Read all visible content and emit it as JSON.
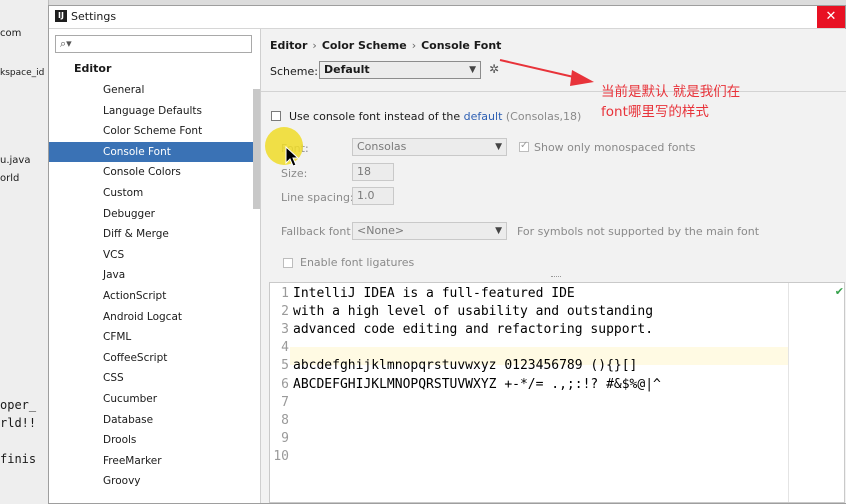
{
  "background_ide": {
    "lines": [
      "com",
      "kspace_id",
      "u.java",
      "orld",
      "oper_",
      "rld!!",
      "finis"
    ]
  },
  "window": {
    "title": "Settings",
    "icon_text": "IJ",
    "close_label": "✕"
  },
  "left_panel": {
    "search_icon": "search-icon",
    "root": "Editor",
    "items": [
      "General",
      "Language Defaults",
      "Color Scheme Font",
      "Console Font",
      "Console Colors",
      "Custom",
      "Debugger",
      "Diff & Merge",
      "VCS",
      "Java",
      "ActionScript",
      "Android Logcat",
      "CFML",
      "CoffeeScript",
      "CSS",
      "Cucumber",
      "Database",
      "Drools",
      "FreeMarker",
      "Groovy"
    ],
    "selected_index": 3
  },
  "breadcrumb": [
    "Editor",
    "Color Scheme",
    "Console Font"
  ],
  "scheme": {
    "label": "Scheme:",
    "value": "Default"
  },
  "use_console_font": {
    "label_prefix": "Use console font instead of the",
    "link": "default",
    "suffix": "(Consolas,18)",
    "checked": false
  },
  "font": {
    "font_label": "Font:",
    "font_value": "Consolas",
    "monospaced_label": "Show only monospaced fonts",
    "monospaced_checked": true,
    "size_label": "Size:",
    "size_value": "18",
    "spacing_label": "Line spacing:",
    "spacing_value": "1.0",
    "fallback_label": "Fallback font:",
    "fallback_value": "<None>",
    "fallback_note": "For symbols not supported by the main font",
    "ligatures_label": "Enable font ligatures",
    "ligatures_checked": false
  },
  "editor": {
    "line_numbers": [
      "1",
      "2",
      "3",
      "4",
      "5",
      "6",
      "7",
      "8",
      "9",
      "10"
    ],
    "lines": [
      "IntelliJ IDEA is a full-featured IDE",
      "with a high level of usability and outstanding",
      "advanced code editing and refactoring support.",
      "",
      "abcdefghijklmnopqrstuvwxyz 0123456789 (){}[]",
      "ABCDEFGHIJKLMNOPQRSTUVWXYZ +-*/= .,;:!? #&$%@|^",
      "",
      "",
      "",
      ""
    ]
  },
  "annotation": {
    "line1": "当前是默认  就是我们在",
    "line2": "font哪里写的样式",
    "color": "#e8333a"
  },
  "colors": {
    "selection": "#3a72b5",
    "link": "#2d5fb3",
    "highlight": "#f0dc28"
  }
}
